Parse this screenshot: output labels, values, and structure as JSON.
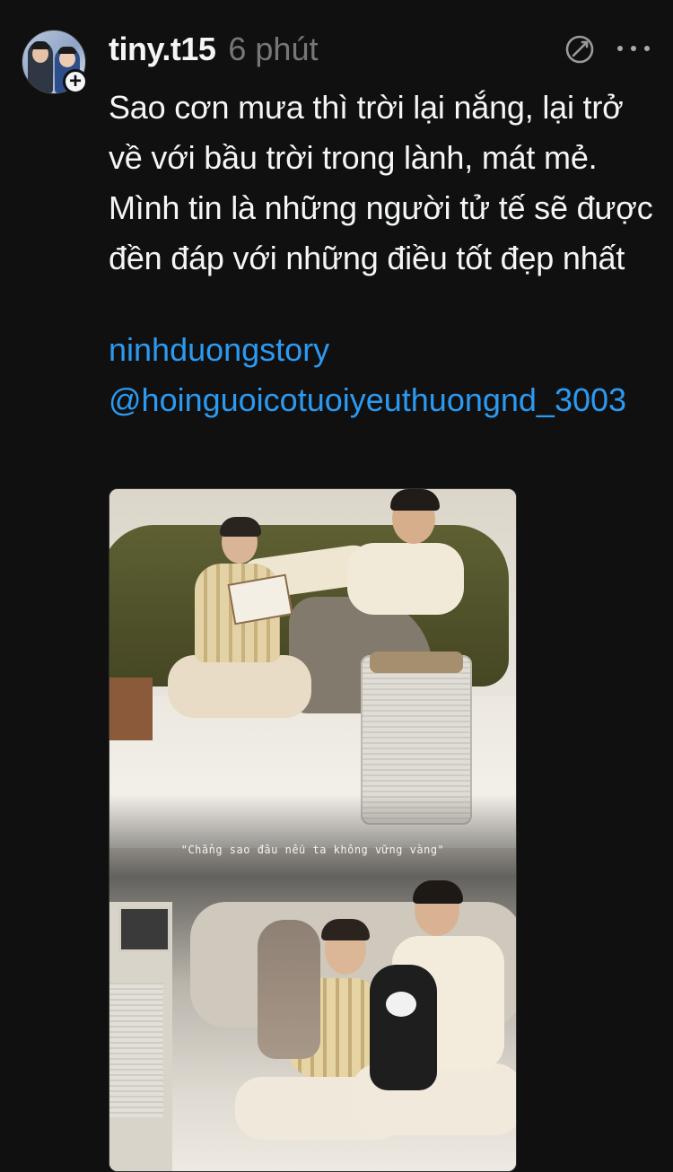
{
  "post": {
    "username": "tiny.t15",
    "time": "6 phút",
    "avatar_alt": "profile avatar",
    "follow_badge": "+",
    "caption": "Sao cơn mưa thì trời lại nắng, lại trở về với bầu trời trong lành, mát mẻ. Mình tin là những người tử tế sẽ được đền đáp với những điều tốt đẹp nhất",
    "tags": {
      "hashtag": "ninhduongstory",
      "mention": "@hoinguoicotuoiyeuthuongnd_3003"
    },
    "media": {
      "overlay_text": "\"Chẳng sao đâu nếu ta không vững vàng\""
    }
  },
  "icons": {
    "translate": "translate-icon",
    "more": "more-options-icon"
  },
  "colors": {
    "background": "#101010",
    "text": "#f3f5f7",
    "muted": "#777777",
    "link": "#2c9af1"
  }
}
